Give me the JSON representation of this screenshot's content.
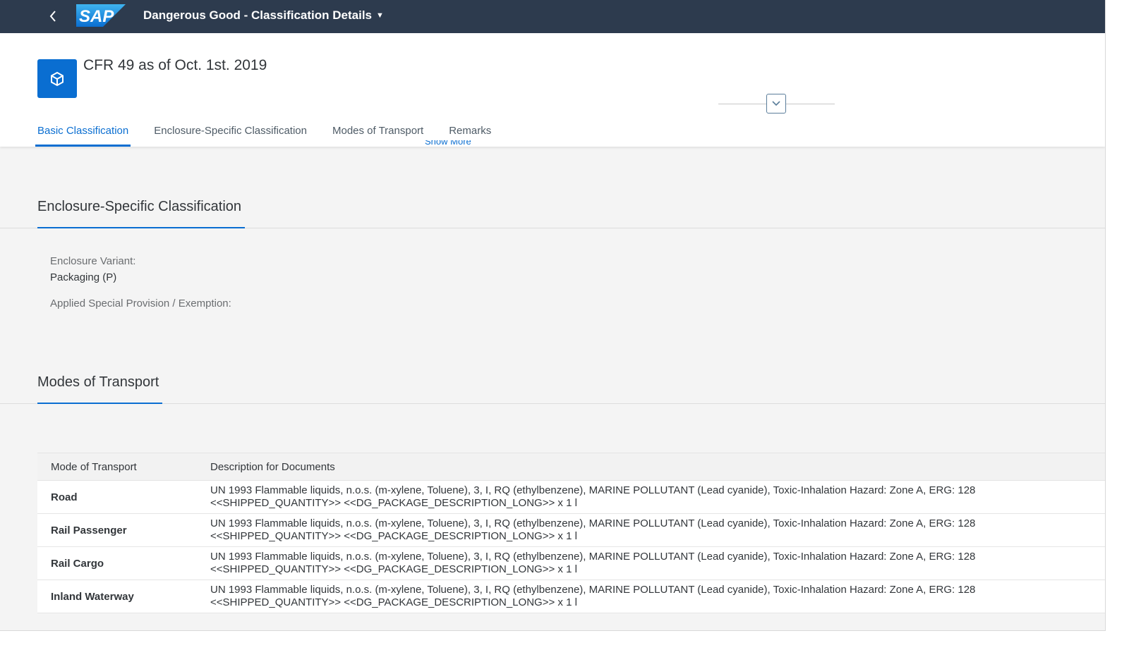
{
  "shell": {
    "logo_text": "SAP",
    "app_title": "Dangerous Good - Classification Details"
  },
  "header": {
    "object_title": "CFR 49 as of Oct. 1st. 2019",
    "show_more": "Show More"
  },
  "tabs": [
    {
      "label": "Basic Classification",
      "active": true
    },
    {
      "label": "Enclosure-Specific Classification",
      "active": false
    },
    {
      "label": "Modes of Transport",
      "active": false
    },
    {
      "label": "Remarks",
      "active": false
    }
  ],
  "enclosure_section": {
    "title": "Enclosure-Specific Classification",
    "enclosure_variant_label": "Enclosure Variant:",
    "enclosure_variant_value": "Packaging (P)",
    "special_provision_label": "Applied Special Provision / Exemption:"
  },
  "modes_section": {
    "title": "Modes of Transport",
    "columns": [
      "Mode of Transport",
      "Description for Documents"
    ],
    "rows": [
      {
        "mode": "Road",
        "desc_line1": "UN 1993 Flammable liquids, n.o.s. (m-xylene, Toluene), 3, I, RQ (ethylbenzene), MARINE POLLUTANT (Lead cyanide), Toxic-Inhalation Hazard: Zone A, ERG: 128",
        "desc_line2": "<<SHIPPED_QUANTITY>> <<DG_PACKAGE_DESCRIPTION_LONG>> x 1 l"
      },
      {
        "mode": "Rail Passenger",
        "desc_line1": "UN 1993 Flammable liquids, n.o.s. (m-xylene, Toluene), 3, I, RQ (ethylbenzene), MARINE POLLUTANT (Lead cyanide), Toxic-Inhalation Hazard: Zone A, ERG: 128",
        "desc_line2": "<<SHIPPED_QUANTITY>> <<DG_PACKAGE_DESCRIPTION_LONG>> x 1 l"
      },
      {
        "mode": "Rail Cargo",
        "desc_line1": "UN 1993 Flammable liquids, n.o.s. (m-xylene, Toluene), 3, I, RQ (ethylbenzene), MARINE POLLUTANT (Lead cyanide), Toxic-Inhalation Hazard: Zone A, ERG: 128",
        "desc_line2": "<<SHIPPED_QUANTITY>> <<DG_PACKAGE_DESCRIPTION_LONG>> x 1 l"
      },
      {
        "mode": "Inland Waterway",
        "desc_line1": "UN 1993 Flammable liquids, n.o.s. (m-xylene, Toluene), 3, I, RQ (ethylbenzene), MARINE POLLUTANT (Lead cyanide), Toxic-Inhalation Hazard: Zone A, ERG: 128",
        "desc_line2": "<<SHIPPED_QUANTITY>> <<DG_PACKAGE_DESCRIPTION_LONG>> x 1 l"
      }
    ]
  },
  "colors": {
    "shellbar": "#2d3b4e",
    "accent": "#0a6ed1",
    "background": "#f4f4f4"
  },
  "icons": {
    "back": "chevron-left-icon",
    "title_menu": "caret-down-icon",
    "object": "product-box-icon",
    "collapse": "chevron-down-icon"
  }
}
